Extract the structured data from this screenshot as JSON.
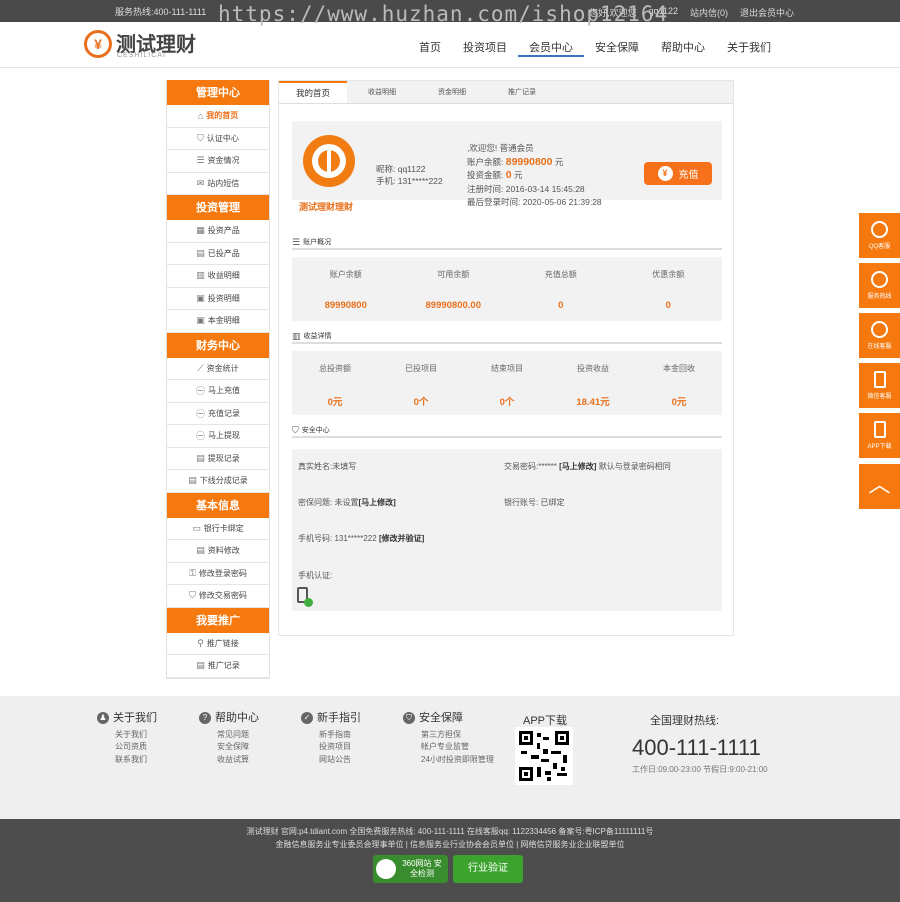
{
  "topbar": {
    "hotline": "服务热线:400-111-1111",
    "greeting": "您好,欢迎您",
    "username": "qq1122",
    "inbox": "站内信(0)",
    "logout": "退出会员中心"
  },
  "logo": {
    "title": "测试理财",
    "subtitle": "CESHILICAI"
  },
  "watermark": "https://www.huzhan.com/ishop12164",
  "nav": [
    "首页",
    "投资项目",
    "会员中心",
    "安全保障",
    "帮助中心",
    "关于我们"
  ],
  "sidebar": [
    {
      "title": "管理中心",
      "items": [
        {
          "icon": "home-icon",
          "label": "我的首页",
          "active": true
        },
        {
          "icon": "shield-icon",
          "label": "认证中心"
        },
        {
          "icon": "list-icon",
          "label": "资金情况"
        },
        {
          "icon": "mail-icon",
          "label": "站内短信"
        }
      ]
    },
    {
      "title": "投资管理",
      "items": [
        {
          "icon": "grid-icon",
          "label": "投资产品"
        },
        {
          "icon": "doc-icon",
          "label": "已投产品"
        },
        {
          "icon": "bar-icon",
          "label": "收益明细"
        },
        {
          "icon": "calendar-icon",
          "label": "投资明细"
        },
        {
          "icon": "calendar-icon",
          "label": "本金明细"
        }
      ]
    },
    {
      "title": "财务中心",
      "items": [
        {
          "icon": "chart-icon",
          "label": "资金统计"
        },
        {
          "icon": "yen-icon",
          "label": "马上充值"
        },
        {
          "icon": "yen-icon",
          "label": "充值记录"
        },
        {
          "icon": "yen-icon",
          "label": "马上提现"
        },
        {
          "icon": "doc-icon",
          "label": "提现记录"
        },
        {
          "icon": "doc-icon",
          "label": "下线分成记录"
        }
      ]
    },
    {
      "title": "基本信息",
      "items": [
        {
          "icon": "card-icon",
          "label": "银行卡绑定"
        },
        {
          "icon": "doc-icon",
          "label": "资料修改"
        },
        {
          "icon": "lock-icon",
          "label": "修改登录密码"
        },
        {
          "icon": "shield-icon",
          "label": "修改交易密码"
        }
      ]
    },
    {
      "title": "我要推广",
      "items": [
        {
          "icon": "link-icon",
          "label": "推广链接"
        },
        {
          "icon": "doc-icon",
          "label": "推广记录"
        }
      ]
    }
  ],
  "tabs": [
    "我的首页",
    "收益明细",
    "资金明细",
    "推广记录"
  ],
  "profile": {
    "name": "测试理财理财",
    "nick": "昵称: qq1122",
    "phone": "手机: 131*****222",
    "welcome": ",欢迎您! 普通会员",
    "balance_label": "账户余额:",
    "balance": "89990800",
    "unit": "元",
    "invest_label": "投资金额:",
    "invest": "0",
    "reg": "注册时间: 2016-03-14 15:45:28",
    "last": "最后登录时间: 2020-05-06 21:39:28",
    "charge": "充值"
  },
  "account": {
    "title": "账户概况",
    "labels": [
      "账户余额",
      "可用余额",
      "充值总额",
      "优惠余额"
    ],
    "values": [
      "89990800",
      "89990800.00",
      "0",
      "0"
    ]
  },
  "income": {
    "title": "收益详情",
    "labels": [
      "总投资额",
      "已投项目",
      "结束项目",
      "投资收益",
      "本金回收"
    ],
    "values": [
      "0元",
      "0个",
      "0个",
      "18.41元",
      "0元"
    ]
  },
  "security": {
    "title": "安全中心",
    "realname": "真实姓名:未填写",
    "tradepwd": "交易密码:******",
    "tradepwd_link": "[马上修改]",
    "tradepwd_note": "默认与登录密码相同",
    "question": "密保问题: 未设置",
    "question_link": "[马上修改]",
    "bank": "银行账号: 已绑定",
    "mobile": "手机号码: 131*****222",
    "mobile_link": "[修改并验证]",
    "auth": "手机认证:"
  },
  "floatbar": [
    "QQ客服",
    "服务热线",
    "在线客服",
    "微信客服",
    "APP下载"
  ],
  "footer": {
    "cols": [
      {
        "title": "关于我们",
        "items": [
          "关于我们",
          "公司资质",
          "联系我们"
        ]
      },
      {
        "title": "帮助中心",
        "items": [
          "常见问题",
          "安全保障",
          "收益试算"
        ]
      },
      {
        "title": "新手指引",
        "items": [
          "新手指南",
          "投资项目",
          "网站公告"
        ]
      },
      {
        "title": "安全保障",
        "items": [
          "第三方担保",
          "帐户专业监管",
          "24小时投资即限管理"
        ]
      }
    ],
    "app": "APP下载",
    "hotline_title": "全国理财热线:",
    "hotline": "400-111-1111",
    "hours": "工作日:09:00-23:00 节假日:9:00-21:00"
  },
  "bottom": {
    "line1": "测试理财 官网:p4.tdiant.com 全国免费服务热线: 400-111-1111 在线客服qq: 1122334456 备案号:粤ICP备11111111号",
    "line2": "金融信息服务业专业委员会理事单位 | 信息服务业行业协会会员单位 | 网络信贷服务业企业联盟单位",
    "badge1": "360网站 安全检测",
    "badge2": "行业验证"
  }
}
